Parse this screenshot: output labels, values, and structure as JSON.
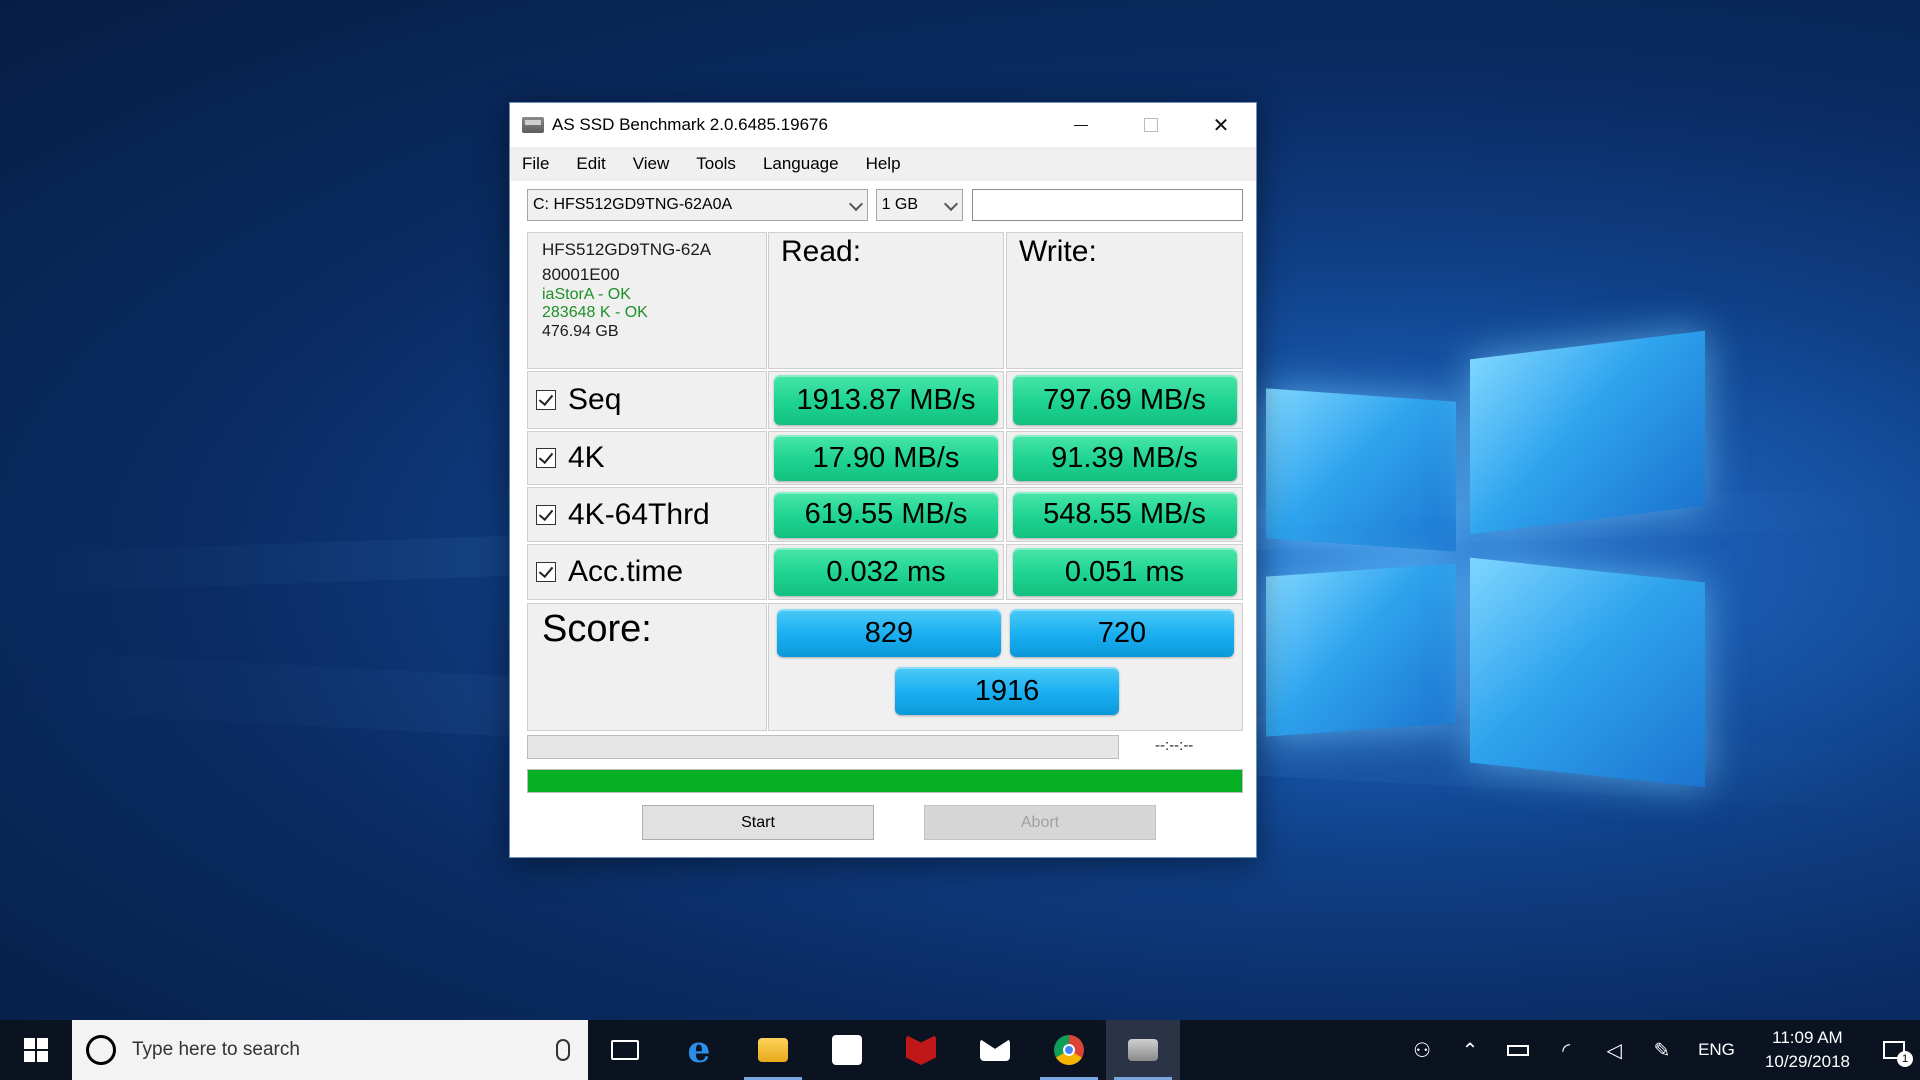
{
  "window": {
    "title": "AS SSD Benchmark 2.0.6485.19676",
    "close_glyph": "✕"
  },
  "menu": [
    "File",
    "Edit",
    "View",
    "Tools",
    "Language",
    "Help"
  ],
  "toolbar": {
    "drive": "C: HFS512GD9TNG-62A0A",
    "size": "1 GB",
    "text_value": ""
  },
  "info": {
    "model": "HFS512GD9TNG-62A",
    "firmware": "80001E00",
    "driver": "iaStorA - OK",
    "alignment": "283648 K - OK",
    "capacity": "476.94 GB"
  },
  "headers": {
    "read": "Read:",
    "write": "Write:"
  },
  "rows": [
    {
      "label": "Seq",
      "read": "1913.87 MB/s",
      "write": "797.69 MB/s",
      "checked": true
    },
    {
      "label": "4K",
      "read": "17.90 MB/s",
      "write": "91.39 MB/s",
      "checked": true
    },
    {
      "label": "4K-64Thrd",
      "read": "619.55 MB/s",
      "write": "548.55 MB/s",
      "checked": true
    },
    {
      "label": "Acc.time",
      "read": "0.032 ms",
      "write": "0.051 ms",
      "checked": true
    }
  ],
  "score": {
    "label": "Score:",
    "read": "829",
    "write": "720",
    "total": "1916"
  },
  "progress": {
    "time": "--:--:--",
    "overall_fraction": 1.0
  },
  "buttons": {
    "start": "Start",
    "abort": "Abort"
  },
  "taskbar": {
    "search_placeholder": "Type here to search",
    "apps": [
      "task-view-icon",
      "edge-icon",
      "file-explorer-icon",
      "store-icon",
      "mcafee-icon",
      "mail-icon",
      "chrome-icon",
      "as-ssd-icon"
    ],
    "edge_glyph": "e",
    "lang": "ENG",
    "time": "11:09 AM",
    "date": "10/29/2018",
    "notifications_count": "1"
  },
  "colors": {
    "result_green": "#1ed391",
    "score_blue": "#18aef0",
    "progress_green": "#06b025",
    "ok_text": "#1f8f2b"
  }
}
